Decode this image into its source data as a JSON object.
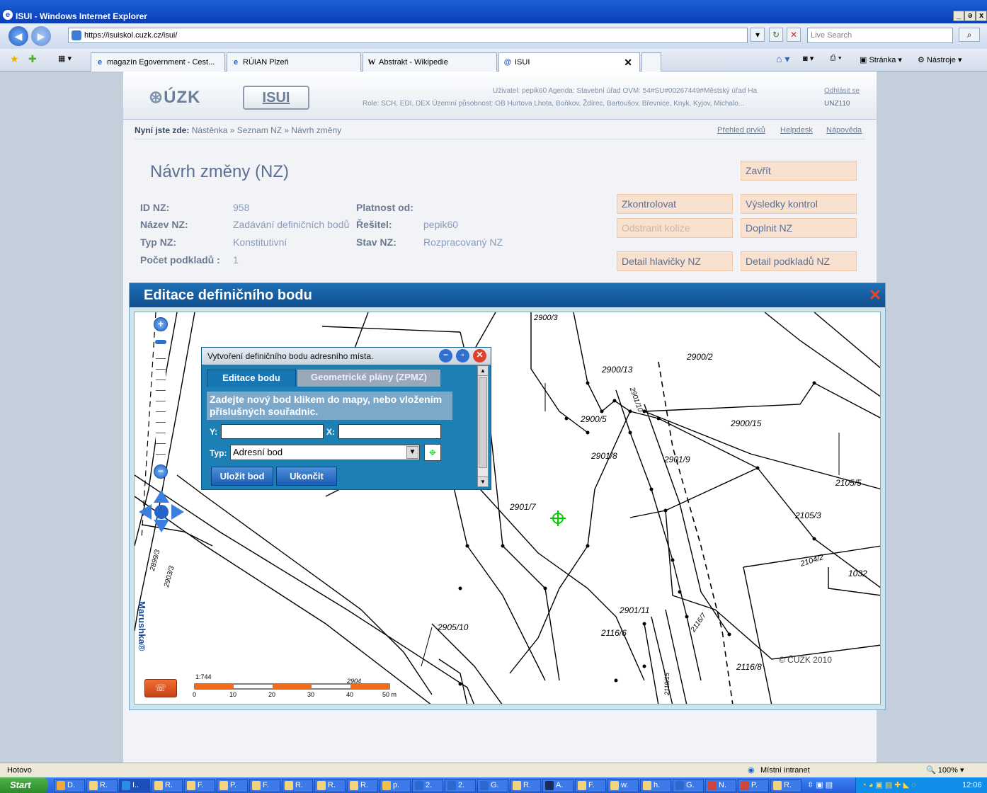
{
  "window": {
    "title": "ISUI - Windows Internet Explorer",
    "minimize": "_",
    "restore": "ə",
    "close": "x"
  },
  "address": {
    "url": "https://isuiskol.cuzk.cz/isui/",
    "search_placeholder": "Live Search"
  },
  "tabs": [
    {
      "label": "magazín Egovernment - Cest..."
    },
    {
      "label": "RÚIAN Plzeň"
    },
    {
      "label": "Abstrakt - Wikipedie"
    },
    {
      "label": "ISUI"
    }
  ],
  "toolbar": {
    "page_label": "Stránka",
    "tools_label": "Nástroje"
  },
  "header": {
    "logo_cuzk": "ÚZK",
    "logo_isui": "ISUI",
    "user_line": "Uživatel: pepik60   Agenda: Stavební úřad   OVM: 54#SU#00267449#Městský úřad Ha",
    "role_line": "Role: SCH, EDI, DEX   Územní působnost: OB Hurtova Lhota, Boňkov, Ždírec, Bartoušov, Břevnice, Knyk, Kyjov, Michalo...",
    "logout": "Odhlásit se",
    "code": "UNZ110"
  },
  "breadcrumb": {
    "label": "Nyní jste zde:",
    "path": "Nástěnka » Seznam NZ » Návrh změny"
  },
  "toplinks": [
    "Přehled prvků",
    "Helpdesk",
    "Nápověda"
  ],
  "page": {
    "title": "Návrh změny (NZ)"
  },
  "fields": [
    {
      "label": "ID NZ:",
      "value": "958"
    },
    {
      "label": "Název NZ:",
      "value": "Zadávání definičních bodů"
    },
    {
      "label": "Typ NZ:",
      "value": "Konstitutivní"
    },
    {
      "label": "Počet podkladů :",
      "value": "1"
    },
    {
      "label": "Platnost od:",
      "value": ""
    },
    {
      "label": "Řešitel:",
      "value": "pepik60"
    },
    {
      "label": "Stav NZ:",
      "value": "Rozpracovaný NZ"
    }
  ],
  "actions": {
    "close": "Zavřít",
    "check": "Zkontrolovat",
    "results": "Výsledky kontrol",
    "remove": "Odstranit kolize",
    "complete": "Doplnit NZ",
    "header_detail": "Detail hlavičky NZ",
    "sources_detail": "Detail podkladů NZ"
  },
  "editor": {
    "title": "Editace definičního bodu",
    "close": "✕"
  },
  "dialog": {
    "title": "Vytvoření definičního bodu adresního místa.",
    "tab_edit": "Editace bodu",
    "tab_plans": "Geometrické plány (ZPMZ)",
    "hint": "Zadejte nový bod klikem do mapy, nebo vložením příslušných souřadnic.",
    "y_label": "Y:",
    "x_label": "X:",
    "y_value": "",
    "x_value": "",
    "type_label": "Typ:",
    "type_value": "Adresní bod",
    "save": "Uložit bod",
    "end": "Ukončit"
  },
  "map": {
    "parcels": [
      "2900/3",
      "2900/2",
      "2900/13",
      "2901/10",
      "2900/5",
      "2900/15",
      "2901/8",
      "2901/9",
      "2105/5",
      "2901/7",
      "2105/3",
      "2104/2",
      "1032",
      "2901/11",
      "2116/7",
      "2116/6",
      "2905/10",
      "2116/8",
      "2899/3",
      "2903/3",
      "2119/15",
      "2904"
    ],
    "copyright": "© ČÚZK 2010",
    "scale": "1:744",
    "scale_ticks": [
      "0",
      "10",
      "20",
      "30",
      "40",
      "50 m"
    ],
    "vendor": "Marushka®"
  },
  "status": {
    "text": "Hotovo",
    "zone": "Místní intranet",
    "zoom": "100%"
  },
  "taskbar": {
    "start": "Start",
    "items": [
      "D.",
      "R.",
      "I..",
      "R.",
      "F.",
      "P.",
      "F.",
      "R.",
      "R.",
      "R.",
      "p.",
      "2.",
      "2.",
      "G.",
      "R.",
      "A.",
      "F.",
      "w.",
      "h.",
      "G.",
      "N.",
      "P.",
      "R."
    ],
    "clock": "12:06"
  }
}
